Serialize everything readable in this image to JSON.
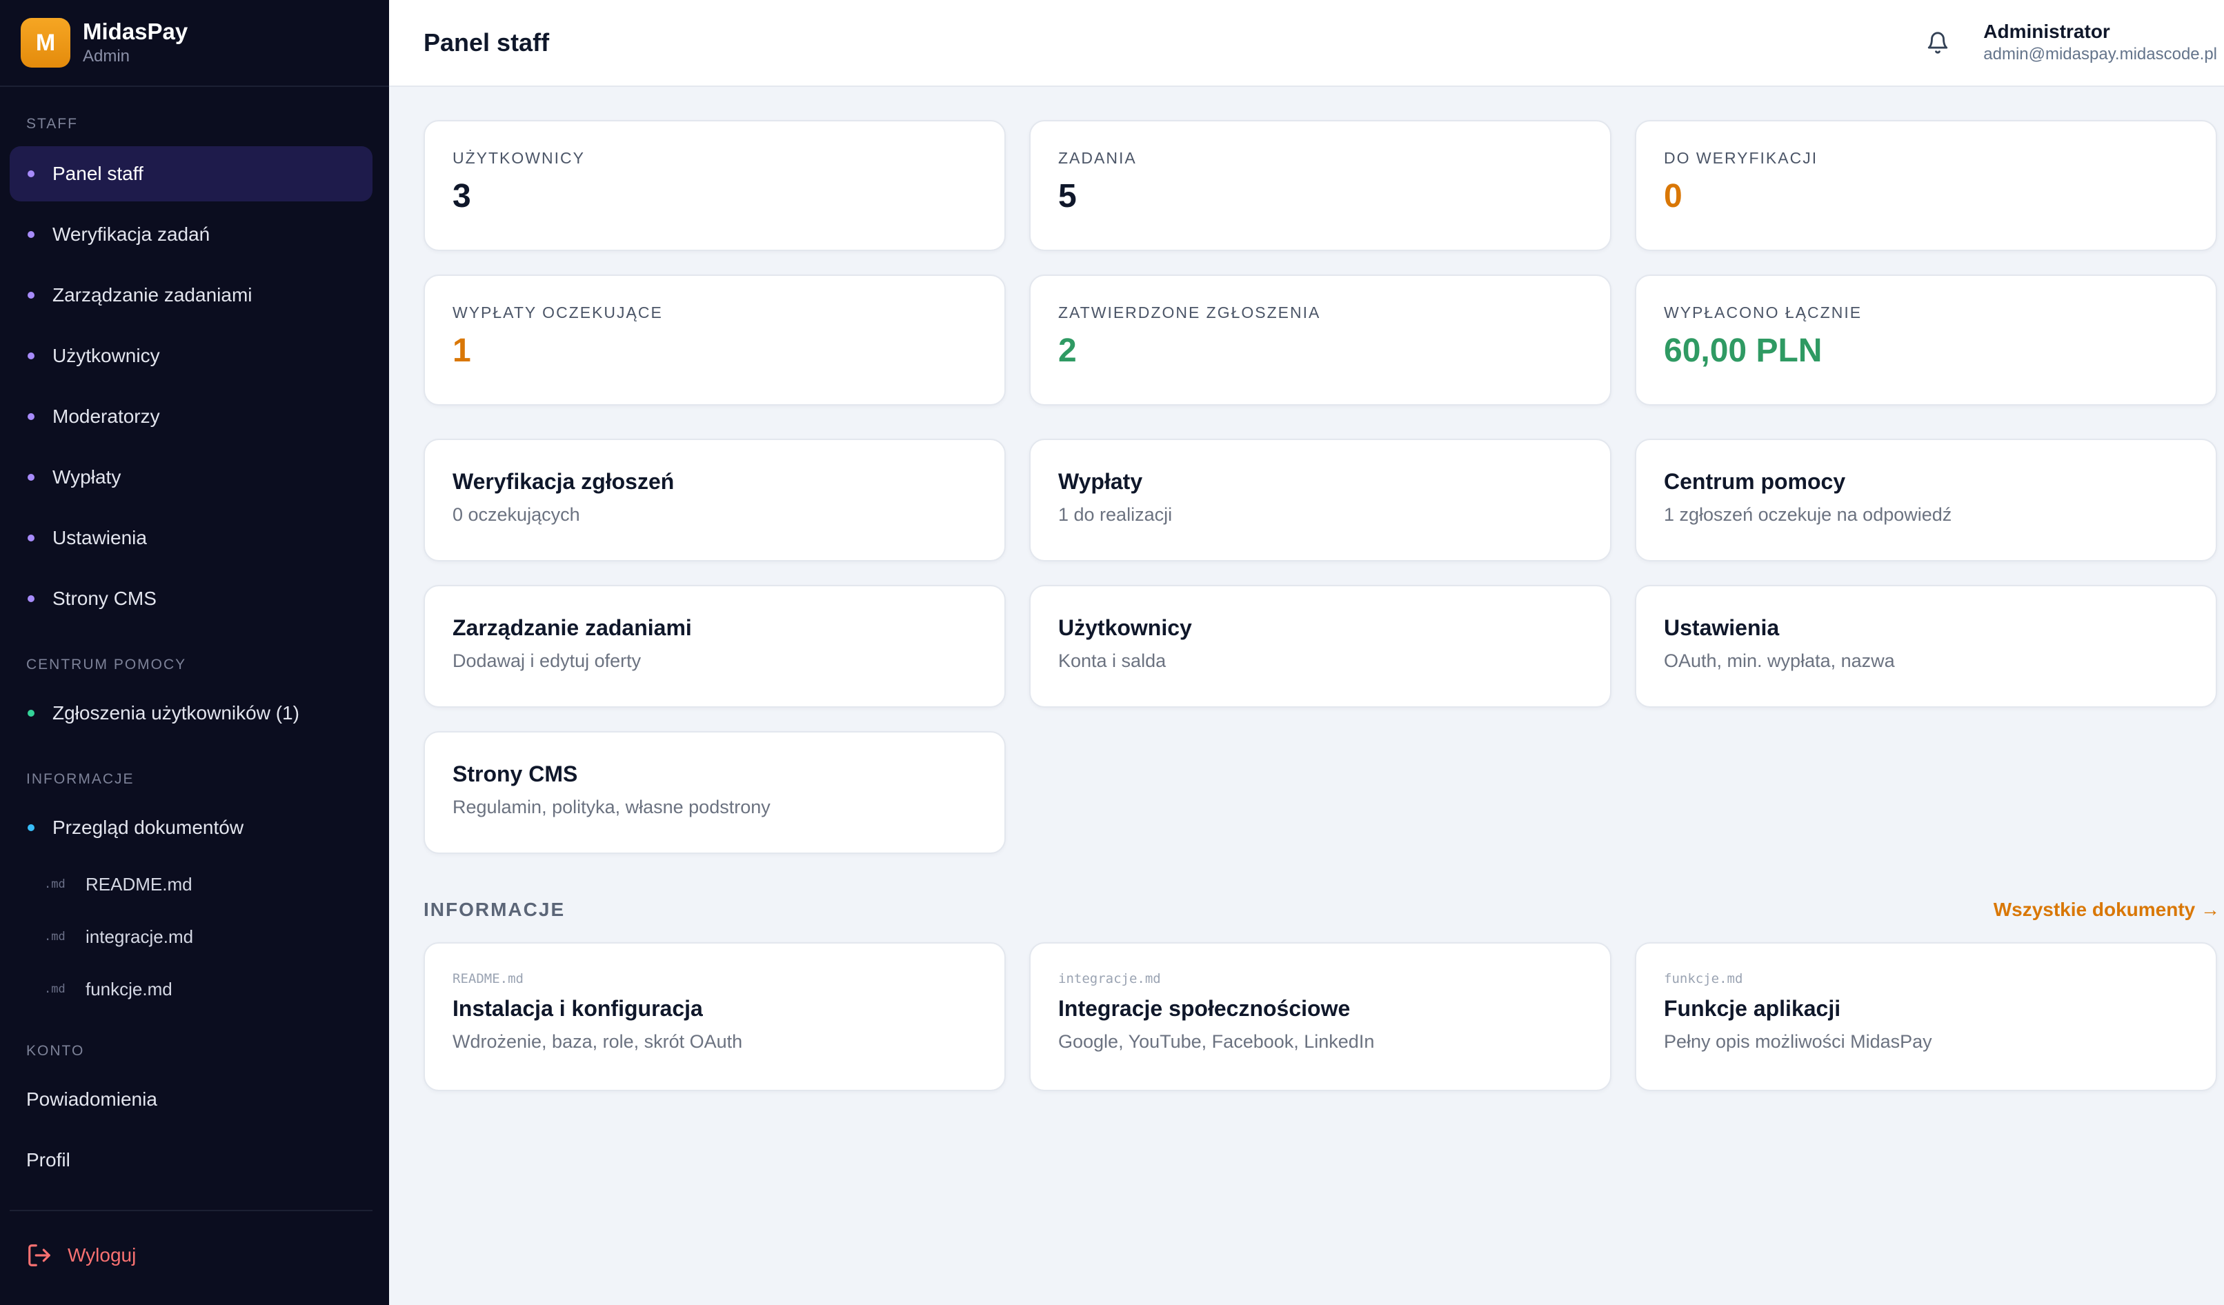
{
  "brand": {
    "logo_letter": "M",
    "name": "MidasPay",
    "role": "Admin"
  },
  "sidebar": {
    "section_staff": "STAFF",
    "staff_items": [
      {
        "label": "Panel staff",
        "active": true
      },
      {
        "label": "Weryfikacja zadań"
      },
      {
        "label": "Zarządzanie zadaniami"
      },
      {
        "label": "Użytkownicy"
      },
      {
        "label": "Moderatorzy"
      },
      {
        "label": "Wypłaty"
      },
      {
        "label": "Ustawienia"
      },
      {
        "label": "Strony CMS"
      }
    ],
    "section_help": "CENTRUM POMOCY",
    "help_item": "Zgłoszenia użytkowników (1)",
    "section_info": "INFORMACJE",
    "info_item": "Przegląd dokumentów",
    "docs": [
      {
        "tag": ".md",
        "label": "README.md"
      },
      {
        "tag": ".md",
        "label": "integracje.md"
      },
      {
        "tag": ".md",
        "label": "funkcje.md"
      }
    ],
    "section_account": "KONTO",
    "account_items": [
      "Powiadomienia",
      "Profil"
    ],
    "logout": "Wyloguj"
  },
  "header": {
    "title": "Panel staff",
    "user_name": "Administrator",
    "user_email": "admin@midaspay.midascode.pl"
  },
  "stats": [
    {
      "label": "UŻYTKOWNICY",
      "value": "3"
    },
    {
      "label": "ZADANIA",
      "value": "5"
    },
    {
      "label": "DO WERYFIKACJI",
      "value": "0"
    },
    {
      "label": "WYPŁATY OCZEKUJĄCE",
      "value": "1"
    },
    {
      "label": "ZATWIERDZONE ZGŁOSZENIA",
      "value": "2"
    },
    {
      "label": "WYPŁACONO ŁĄCZNIE",
      "value": "60,00 PLN"
    }
  ],
  "colors": {
    "orange": "#d97706",
    "green": "#2f9a63",
    "sidebar_bg": "#0b0d1f",
    "accent": "#a78bfa"
  },
  "links": [
    {
      "title": "Weryfikacja zgłoszeń",
      "sub": "0 oczekujących"
    },
    {
      "title": "Wypłaty",
      "sub": "1 do realizacji"
    },
    {
      "title": "Centrum pomocy",
      "sub": "1 zgłoszeń oczekuje na odpowiedź"
    },
    {
      "title": "Zarządzanie zadaniami",
      "sub": "Dodawaj i edytuj oferty"
    },
    {
      "title": "Użytkownicy",
      "sub": "Konta i salda"
    },
    {
      "title": "Ustawienia",
      "sub": "OAuth, min. wypłata, nazwa"
    },
    {
      "title": "Strony CMS",
      "sub": "Regulamin, polityka, własne podstrony"
    }
  ],
  "info_section": {
    "title": "INFORMACJE",
    "all_docs_link": "Wszystkie dokumenty →",
    "docs": [
      {
        "file": "README.md",
        "title": "Instalacja i konfiguracja",
        "sub": "Wdrożenie, baza, role, skrót OAuth"
      },
      {
        "file": "integracje.md",
        "title": "Integracje społecznościowe",
        "sub": "Google, YouTube, Facebook, LinkedIn"
      },
      {
        "file": "funkcje.md",
        "title": "Funkcje aplikacji",
        "sub": "Pełny opis możliwości MidasPay"
      }
    ]
  }
}
